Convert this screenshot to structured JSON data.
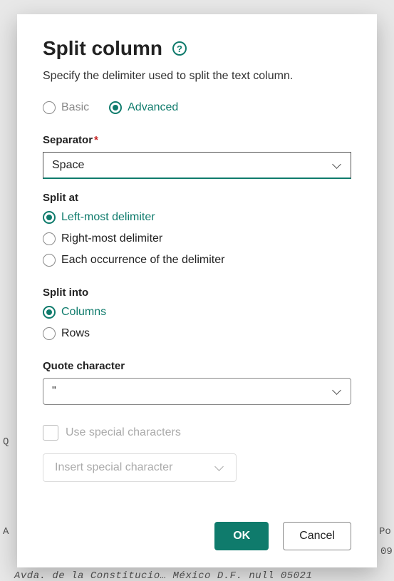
{
  "dialog": {
    "title": "Split column",
    "subtitle": "Specify the delimiter used to split the text column."
  },
  "mode": {
    "basic": "Basic",
    "advanced": "Advanced",
    "selected": "advanced"
  },
  "separator": {
    "label": "Separator",
    "required": "*",
    "value": "Space"
  },
  "split_at": {
    "label": "Split at",
    "options": {
      "left": "Left-most delimiter",
      "right": "Right-most delimiter",
      "each": "Each occurrence of the delimiter"
    },
    "selected": "left"
  },
  "split_into": {
    "label": "Split into",
    "options": {
      "columns": "Columns",
      "rows": "Rows"
    },
    "selected": "columns"
  },
  "quote": {
    "label": "Quote character",
    "value": "\""
  },
  "special": {
    "checkbox_label": "Use special characters",
    "insert_label": "Insert special character"
  },
  "buttons": {
    "ok": "OK",
    "cancel": "Cancel"
  },
  "background": {
    "row1_left": "Q",
    "row2_left": "A",
    "row2_right": "Po",
    "row3_right": "09",
    "row4": "Avda. de la Constitucio…  México D.F.          null 05021"
  }
}
